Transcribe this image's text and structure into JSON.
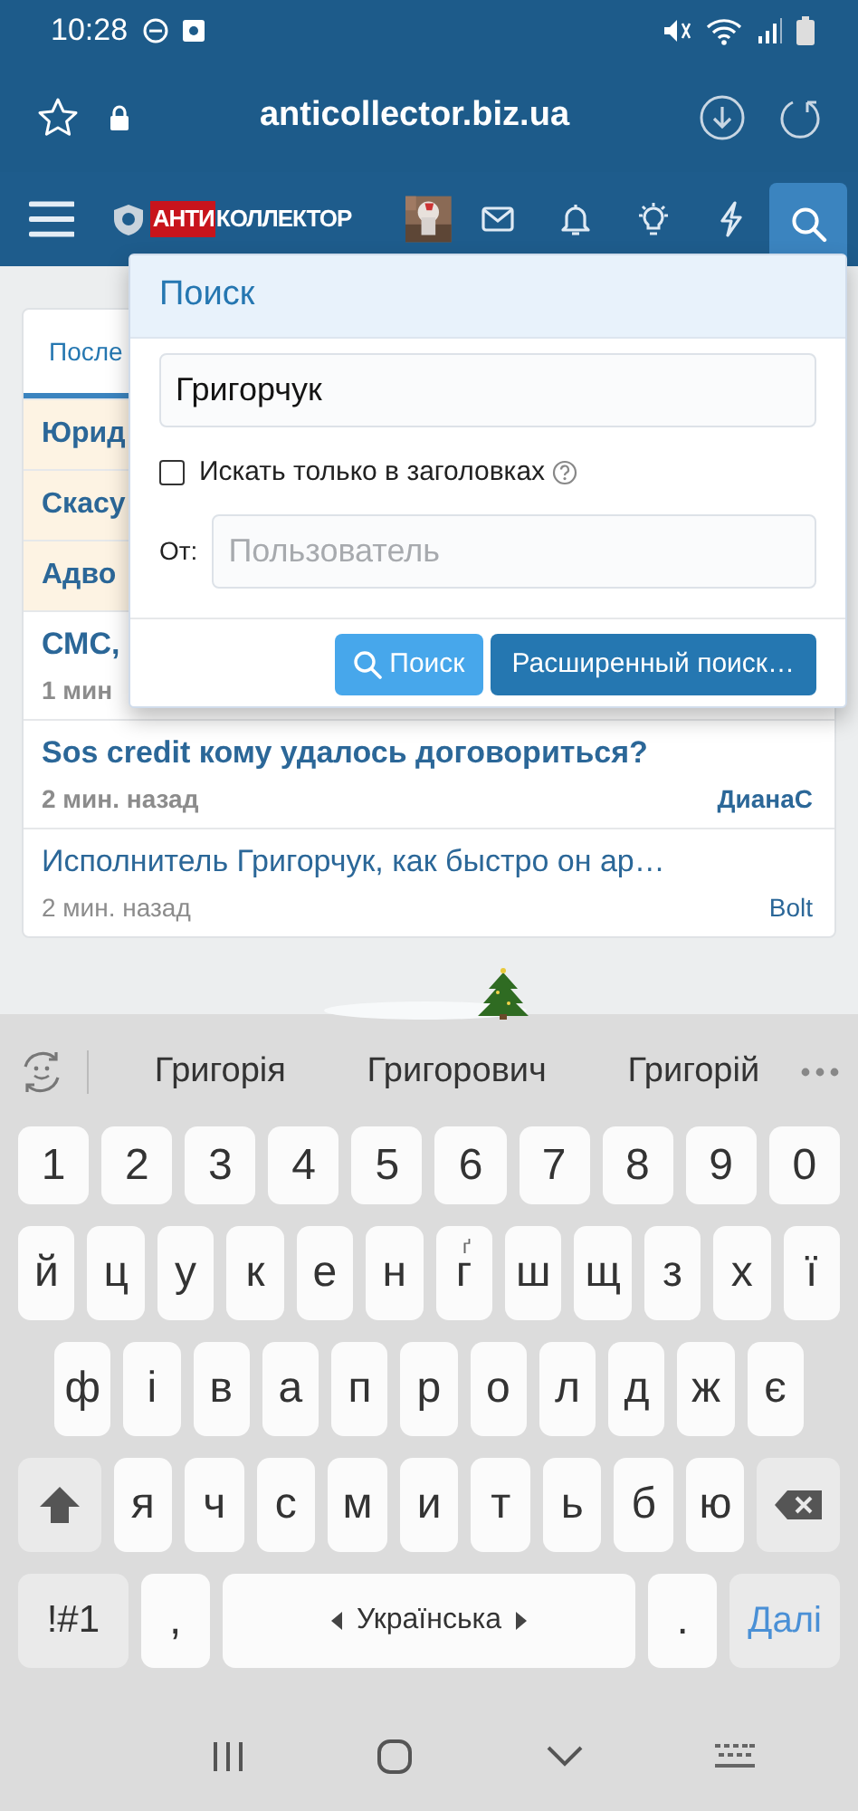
{
  "status_bar": {
    "time": "10:28"
  },
  "browser": {
    "url": "anticollector.biz.ua"
  },
  "site_nav": {
    "logo_red": "АНТИ",
    "logo_rest": "КОЛЛЕКТОР",
    "search_selected": true
  },
  "latest": {
    "tab": "После",
    "threads": [
      {
        "title": "Юрид",
        "highlighted": true,
        "unread": true
      },
      {
        "title": "Скасу",
        "highlighted": true,
        "unread": true
      },
      {
        "title": "Адво",
        "highlighted": true,
        "unread": true
      },
      {
        "title": "СМС,",
        "meta": "1 мин",
        "highlighted": false,
        "unread": true
      },
      {
        "title": "Sos credit кому удалось договориться?",
        "meta": "2 мин. назад",
        "author": "ДианаС",
        "highlighted": false,
        "unread": true
      },
      {
        "title": "Исполнитель Григорчук, как быстро он ар…",
        "meta": "2 мин. назад",
        "author": "Bolt",
        "highlighted": false,
        "unread": false
      }
    ]
  },
  "search_menu": {
    "title": "Поиск",
    "query": "Григорчук",
    "title_only": {
      "label": "Искать только в заголовках",
      "checked": false
    },
    "from_label": "От:",
    "user_placeholder": "Пользователь",
    "search_button": "Поиск",
    "advanced_button": "Расширенный поиск…"
  },
  "keyboard": {
    "suggestions": [
      "Григорія",
      "Григорович",
      "Григорій"
    ],
    "rows": [
      {
        "keys": [
          {
            "kind": "char",
            "label": "1"
          },
          {
            "kind": "char",
            "label": "2"
          },
          {
            "kind": "char",
            "label": "3"
          },
          {
            "kind": "char",
            "label": "4"
          },
          {
            "kind": "char",
            "label": "5"
          },
          {
            "kind": "char",
            "label": "6"
          },
          {
            "kind": "char",
            "label": "7"
          },
          {
            "kind": "char",
            "label": "8"
          },
          {
            "kind": "char",
            "label": "9"
          },
          {
            "kind": "char",
            "label": "0"
          }
        ]
      },
      {
        "keys": [
          {
            "kind": "char",
            "label": "й"
          },
          {
            "kind": "char",
            "label": "ц"
          },
          {
            "kind": "char",
            "label": "у"
          },
          {
            "kind": "char",
            "label": "к"
          },
          {
            "kind": "char",
            "label": "е"
          },
          {
            "kind": "char",
            "label": "н"
          },
          {
            "kind": "char",
            "label": "г",
            "hint": "ґ"
          },
          {
            "kind": "char",
            "label": "ш"
          },
          {
            "kind": "char",
            "label": "щ"
          },
          {
            "kind": "char",
            "label": "з"
          },
          {
            "kind": "char",
            "label": "х"
          },
          {
            "kind": "char",
            "label": "ї"
          }
        ]
      },
      {
        "keys": [
          {
            "kind": "char",
            "label": "ф"
          },
          {
            "kind": "char",
            "label": "і"
          },
          {
            "kind": "char",
            "label": "в"
          },
          {
            "kind": "char",
            "label": "а"
          },
          {
            "kind": "char",
            "label": "п"
          },
          {
            "kind": "char",
            "label": "р"
          },
          {
            "kind": "char",
            "label": "о"
          },
          {
            "kind": "char",
            "label": "л"
          },
          {
            "kind": "char",
            "label": "д"
          },
          {
            "kind": "char",
            "label": "ж"
          },
          {
            "kind": "char",
            "label": "є"
          }
        ]
      },
      {
        "keys": [
          {
            "kind": "shift"
          },
          {
            "kind": "char",
            "label": "я"
          },
          {
            "kind": "char",
            "label": "ч"
          },
          {
            "kind": "char",
            "label": "с"
          },
          {
            "kind": "char",
            "label": "м"
          },
          {
            "kind": "char",
            "label": "и"
          },
          {
            "kind": "char",
            "label": "т"
          },
          {
            "kind": "char",
            "label": "ь"
          },
          {
            "kind": "char",
            "label": "б"
          },
          {
            "kind": "char",
            "label": "ю"
          },
          {
            "kind": "backspace"
          }
        ]
      },
      {
        "keys": [
          {
            "kind": "mode",
            "label": "!#1"
          },
          {
            "kind": "char",
            "label": ","
          },
          {
            "kind": "space",
            "label": "Українська"
          },
          {
            "kind": "char",
            "label": "."
          },
          {
            "kind": "enter",
            "label": "Далі"
          }
        ]
      }
    ]
  }
}
